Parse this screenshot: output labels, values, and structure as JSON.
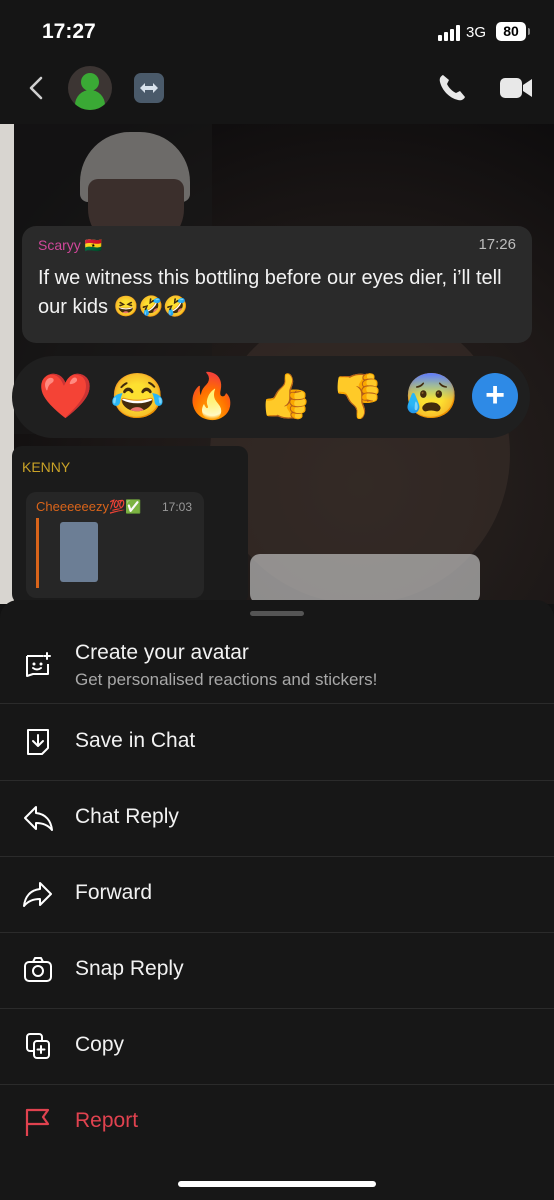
{
  "status": {
    "time": "17:27",
    "network": "3G",
    "battery": "80"
  },
  "message": {
    "sender": "Scaryy 🇬🇭",
    "time": "17:26",
    "text": "If we witness this bottling before our eyes dier, i’ll tell our kids 😆🤣🤣"
  },
  "reactions": [
    "❤️",
    "😂",
    "🔥",
    "👍",
    "👎",
    "😰"
  ],
  "reply_card": {
    "sender": "KENNY",
    "quoted_name": "Cheeeeeezy💯✅",
    "quoted_time": "17:03"
  },
  "menu": {
    "avatar_title": "Create your avatar",
    "avatar_sub": "Get personalised reactions and stickers!",
    "items": [
      "Save in Chat",
      "Chat Reply",
      "Forward",
      "Snap Reply",
      "Copy",
      "Report"
    ]
  },
  "colors": {
    "report": "#e0424f",
    "accent": "#2e8ae6",
    "sender": "#d0479a"
  },
  "icons": {
    "back": "back-chevron-icon",
    "phone": "phone-icon",
    "video": "video-camera-icon",
    "avatar": "avatar-sticker-icon",
    "save": "save-in-chat-icon",
    "reply": "reply-arrow-icon",
    "forward": "forward-arrow-icon",
    "snap": "camera-icon",
    "copy": "copy-icon",
    "report": "flag-icon"
  }
}
